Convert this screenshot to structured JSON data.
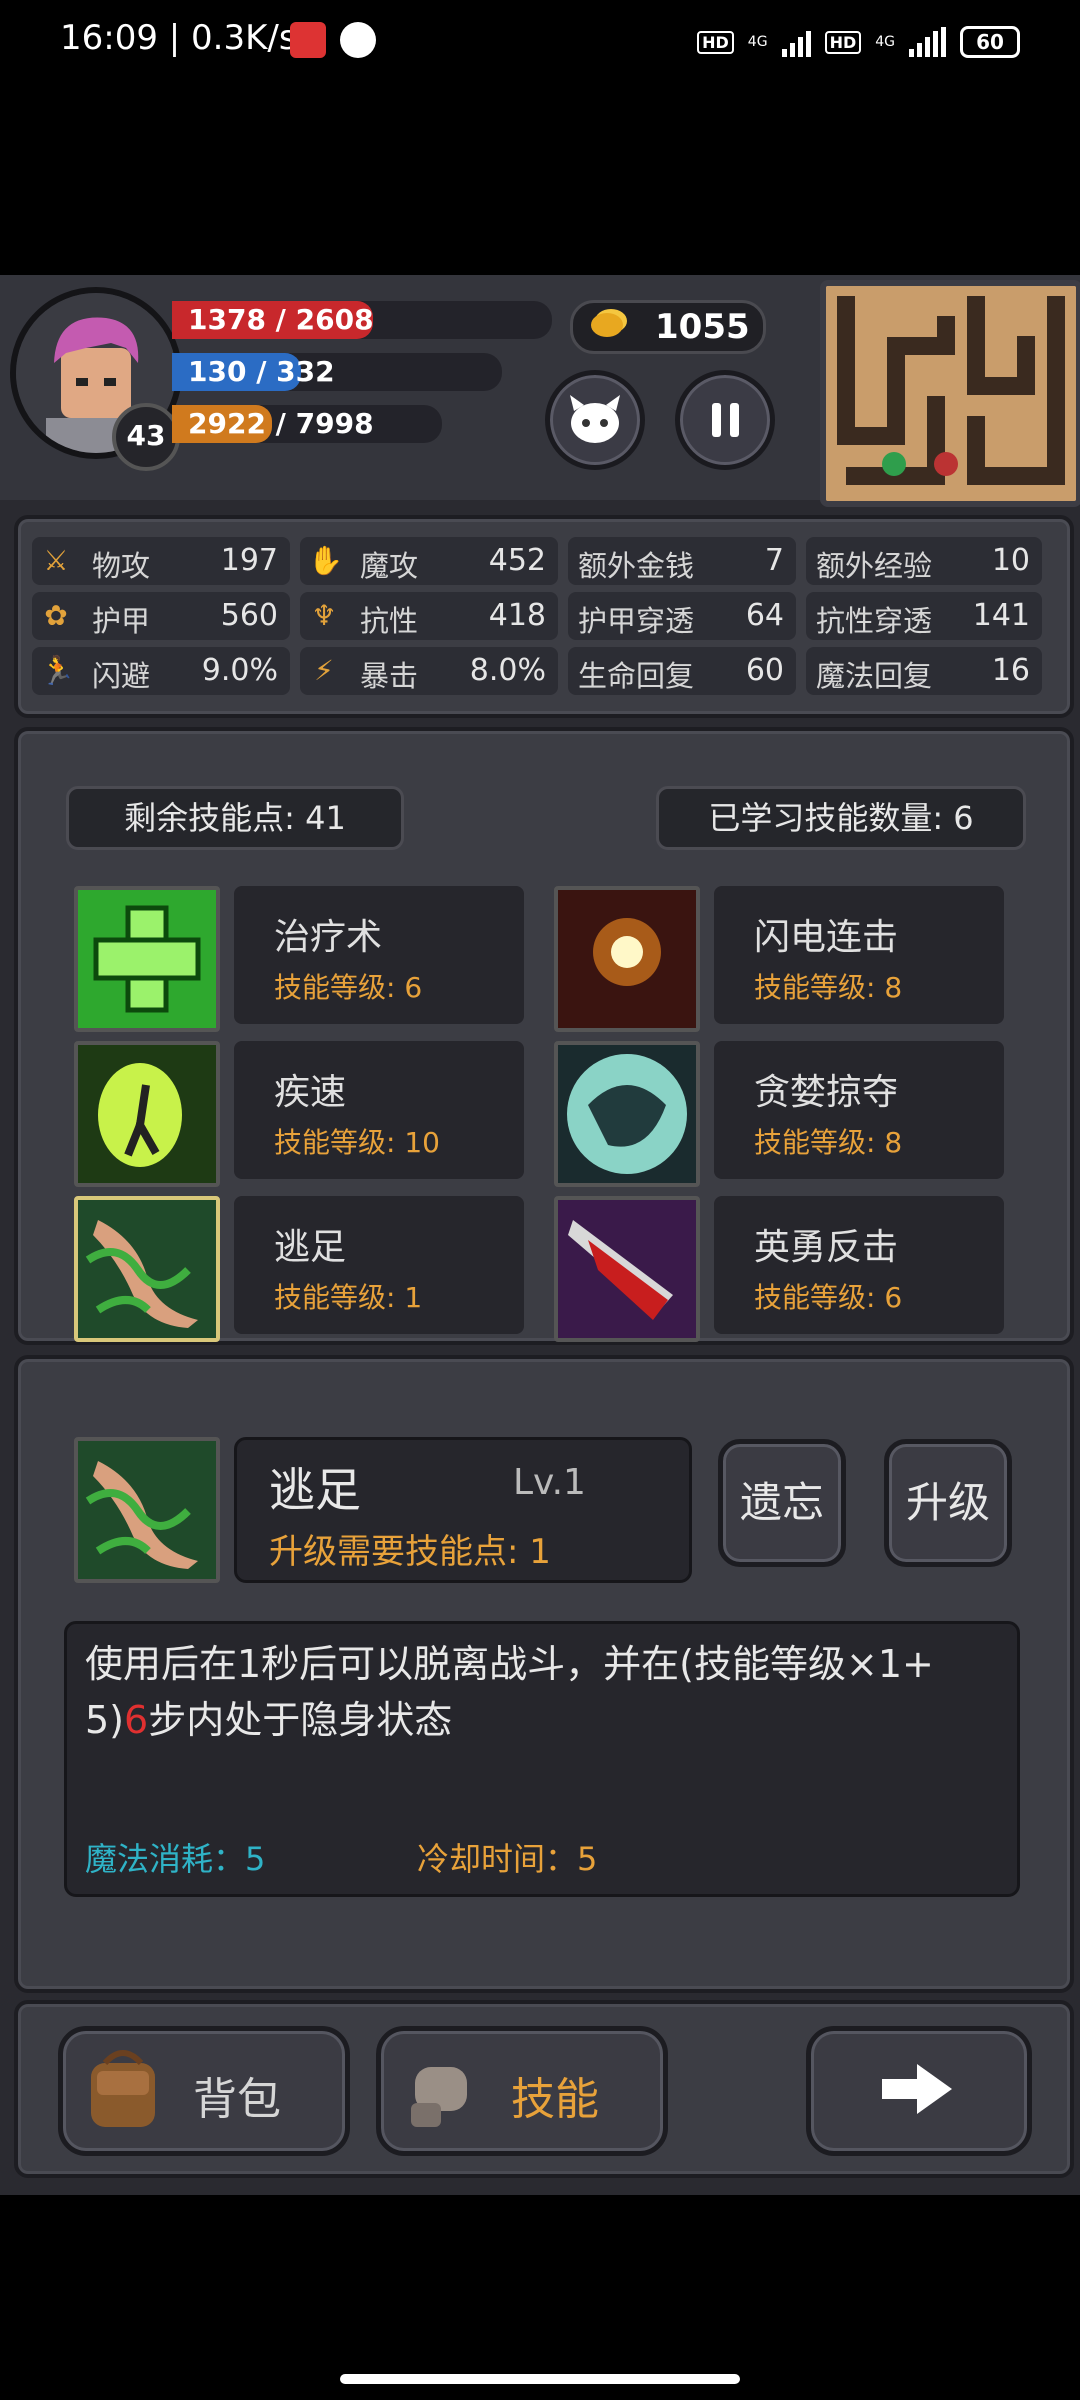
{
  "status_bar": {
    "time": "16:09 | 0.3K/s",
    "net_left": "4G",
    "net_right": "4G",
    "battery": "60",
    "hd1": "HD",
    "hd2": "HD"
  },
  "hud": {
    "level": "43",
    "hp": "1378 / 2608",
    "hp_fraction": 0.53,
    "mp": "130 / 332",
    "mp_fraction": 0.39,
    "exp": "2922 / 7998",
    "exp_fraction": 0.37,
    "gold": "1055",
    "colors": {
      "hp": "#c8282c",
      "mp": "#2b6cc4",
      "exp": "#d07a1e"
    }
  },
  "stats": [
    {
      "icon": "sword-icon",
      "glyph": "⚔",
      "label": "物攻",
      "value": "197"
    },
    {
      "icon": "magic-hand-icon",
      "glyph": "✋",
      "label": "魔攻",
      "value": "452"
    },
    {
      "label": "额外金钱",
      "value": "7"
    },
    {
      "label": "额外经验",
      "value": "10"
    },
    {
      "icon": "paw-shield-icon",
      "glyph": "✿",
      "label": "护甲",
      "value": "560"
    },
    {
      "icon": "resistance-icon",
      "glyph": "♆",
      "label": "抗性",
      "value": "418"
    },
    {
      "label": "护甲穿透",
      "value": "64"
    },
    {
      "label": "抗性穿透",
      "value": "141"
    },
    {
      "icon": "dodge-runner-icon",
      "glyph": "🏃",
      "label": "闪避",
      "value": "9.0%"
    },
    {
      "icon": "lightning-icon",
      "glyph": "⚡",
      "label": "暴击",
      "value": "8.0%"
    },
    {
      "label": "生命回复",
      "value": "60"
    },
    {
      "label": "魔法回复",
      "value": "16"
    }
  ],
  "skills_panel": {
    "remaining": "剩余技能点: 41",
    "learned": "已学习技能数量: 6",
    "skills": [
      {
        "name": "治疗术",
        "level": "技能等级: 6",
        "icon": "heal-cross-icon"
      },
      {
        "name": "闪电连击",
        "level": "技能等级: 8",
        "icon": "lightning-burst-icon"
      },
      {
        "name": "疾速",
        "level": "技能等级: 10",
        "icon": "haste-icon"
      },
      {
        "name": "贪婪掠夺",
        "level": "技能等级: 8",
        "icon": "greed-beast-icon"
      },
      {
        "name": "逃足",
        "level": "技能等级: 1",
        "icon": "vine-foot-icon"
      },
      {
        "name": "英勇反击",
        "level": "技能等级: 6",
        "icon": "bloody-blade-icon"
      }
    ]
  },
  "detail": {
    "name": "逃足",
    "lv": "Lv.1",
    "cost": "升级需要技能点: 1",
    "forget": "遗忘",
    "upgrade": "升级",
    "desc_a": "使用后在1秒后可以脱离战斗，并在(技能等级×1+",
    "desc_b": "5)",
    "desc_c": "6",
    "desc_d": "步内处于隐身状态",
    "mana": "魔法消耗：5",
    "cooldown": "冷却时间：5"
  },
  "bottom": {
    "bag": "背包",
    "skill": "技能"
  }
}
